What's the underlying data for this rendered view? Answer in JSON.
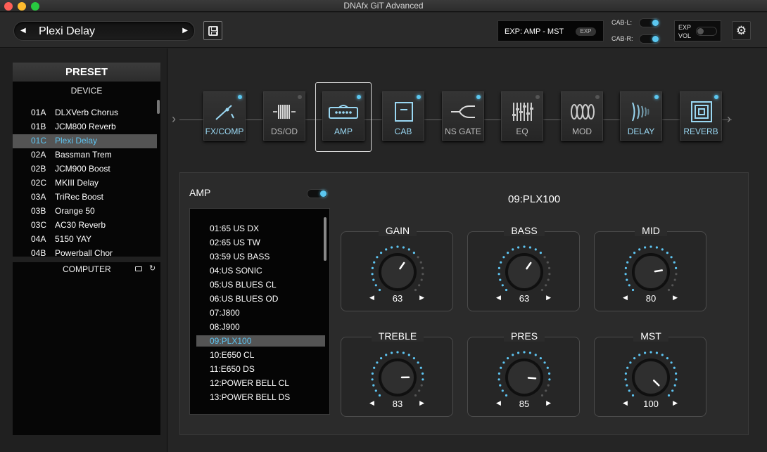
{
  "window": {
    "title": "DNAfx GiT Advanced"
  },
  "topbar": {
    "preset_name": "Plexi Delay",
    "prev_arrow": "◀",
    "next_arrow": "▶",
    "exp_text": "EXP: AMP - MST",
    "exp_badge": "EXP",
    "cab_l": "CAB-L:",
    "cab_r": "CAB-R:",
    "exp_vol_line1": "EXP",
    "exp_vol_line2": "VOL",
    "cab_l_on": true,
    "cab_r_on": true,
    "exp_vol_on": false
  },
  "preset_panel": {
    "header": "PRESET",
    "device_label": "DEVICE",
    "computer_label": "COMPUTER",
    "items": [
      {
        "code": "01A",
        "name": "DLXVerb Chorus"
      },
      {
        "code": "01B",
        "name": "JCM800 Reverb"
      },
      {
        "code": "01C",
        "name": "Plexi Delay"
      },
      {
        "code": "02A",
        "name": "Bassman Trem"
      },
      {
        "code": "02B",
        "name": "JCM900 Boost"
      },
      {
        "code": "02C",
        "name": "MKIII Delay"
      },
      {
        "code": "03A",
        "name": "TriRec Boost"
      },
      {
        "code": "03B",
        "name": "Orange 50"
      },
      {
        "code": "03C",
        "name": "AC30 Reverb"
      },
      {
        "code": "04A",
        "name": "5150 YAY"
      },
      {
        "code": "04B",
        "name": "Powerball Chor"
      }
    ],
    "selected_index": 2
  },
  "chain": {
    "blocks": [
      {
        "label": "FX/COMP",
        "icon": "fx-comp-icon",
        "on": true
      },
      {
        "label": "DS/OD",
        "icon": "ds-od-icon",
        "on": false
      },
      {
        "label": "AMP",
        "icon": "amp-icon",
        "on": true
      },
      {
        "label": "CAB",
        "icon": "cab-icon",
        "on": true
      },
      {
        "label": "NS GATE",
        "icon": "ns-gate-icon",
        "on": true
      },
      {
        "label": "EQ",
        "icon": "eq-icon",
        "on": false
      },
      {
        "label": "MOD",
        "icon": "mod-icon",
        "on": false
      },
      {
        "label": "DELAY",
        "icon": "delay-icon",
        "on": true
      },
      {
        "label": "REVERB",
        "icon": "reverb-icon",
        "on": true
      }
    ],
    "selected_index": 2
  },
  "amp": {
    "title": "AMP",
    "enabled": true,
    "model_name": "09:PLX100",
    "models": [
      "01:65 US DX",
      "02:65 US TW",
      "03:59 US BASS",
      "04:US SONIC",
      "05:US BLUES CL",
      "06:US BLUES OD",
      "07:J800",
      "08:J900",
      "09:PLX100",
      "10:E650 CL",
      "11:E650 DS",
      "12:POWER BELL CL",
      "13:POWER BELL DS"
    ],
    "selected_model_index": 8,
    "knobs": [
      {
        "label": "GAIN",
        "value": 63
      },
      {
        "label": "BASS",
        "value": 63
      },
      {
        "label": "MID",
        "value": 80
      },
      {
        "label": "TREBLE",
        "value": 83
      },
      {
        "label": "PRES",
        "value": 85
      },
      {
        "label": "MST",
        "value": 100
      }
    ],
    "left_arrow": "◀",
    "right_arrow": "▶"
  },
  "colors": {
    "accent": "#5ec5f2",
    "selection": "#545454"
  }
}
